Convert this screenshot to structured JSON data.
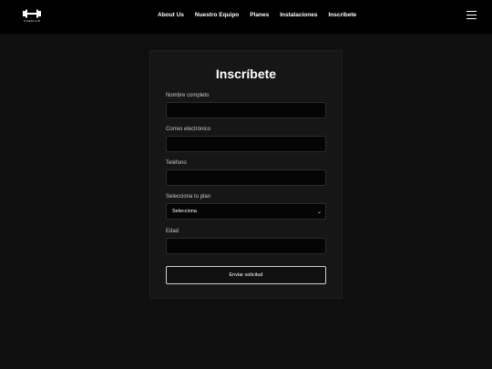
{
  "header": {
    "logo_text": "FITNESS GYM",
    "nav": [
      "About Us",
      "Nuestro Equipo",
      "Planes",
      "Instalaciones",
      "Inscríbete"
    ]
  },
  "form": {
    "title": "Inscríbete",
    "fields": {
      "name_label": "Nombre completo",
      "email_label": "Correo electrónico",
      "phone_label": "Teléfono",
      "plan_label": "Selecciona tu plan",
      "plan_selected": "Selecciona",
      "age_label": "Edad"
    },
    "submit_label": "Enviar solicitud"
  },
  "colors": {
    "background": "#0f0f0f",
    "header": "#000000",
    "card": "#161616",
    "input": "#050505"
  },
  "icons": {
    "logo": "dumbbell-icon",
    "menu": "hamburger-menu-icon",
    "select": "chevron-down-icon"
  }
}
